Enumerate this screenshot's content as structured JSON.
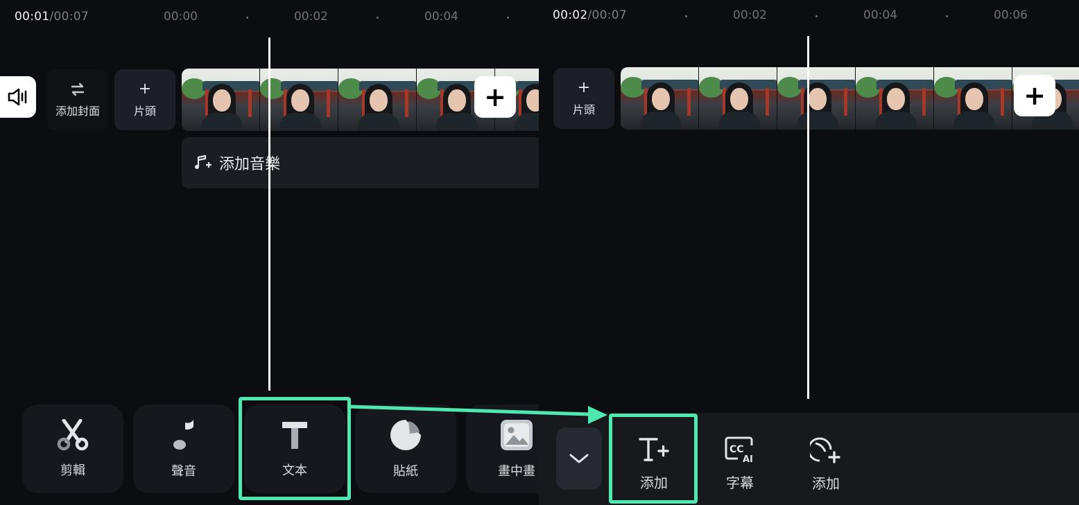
{
  "left": {
    "ruler": {
      "current_time": "00:01",
      "total_time": "/00:07",
      "ticks": [
        "00:00",
        "00:02",
        "00:04"
      ]
    },
    "cover_label": "添加封面",
    "intro_label": "片頭",
    "music_label": "添加音樂",
    "toolbar": {
      "edit_label": "剪輯",
      "audio_label": "聲音",
      "text_label": "文本",
      "sticker_label": "貼紙",
      "pip_label": "畫中畫"
    }
  },
  "right": {
    "ruler": {
      "current_time": "00:02",
      "total_time": "/00:07",
      "ticks": [
        "00:02",
        "00:04",
        "00:06"
      ]
    },
    "intro_label": "片頭",
    "text_toolbar": {
      "add_text_label": "添加",
      "captions_label": "字幕",
      "add_sticker_text_label": "添加"
    }
  },
  "colors": {
    "highlight": "#4ee8b0",
    "background": "#0b0d10",
    "tile": "#1c1f25"
  },
  "icons": {
    "mute": "speaker-icon",
    "swap": "swap-arrows-icon",
    "plus": "plus-icon",
    "music": "music-note-plus-icon",
    "scissors": "scissors-icon",
    "note": "music-note-icon",
    "text": "text-t-icon",
    "sticker": "sticker-icon",
    "pip": "picture-in-picture-icon",
    "chevron": "chevron-down-icon",
    "text_add": "text-add-icon",
    "cc_ai": "cc-ai-icon",
    "sticker_add": "sticker-add-icon"
  }
}
